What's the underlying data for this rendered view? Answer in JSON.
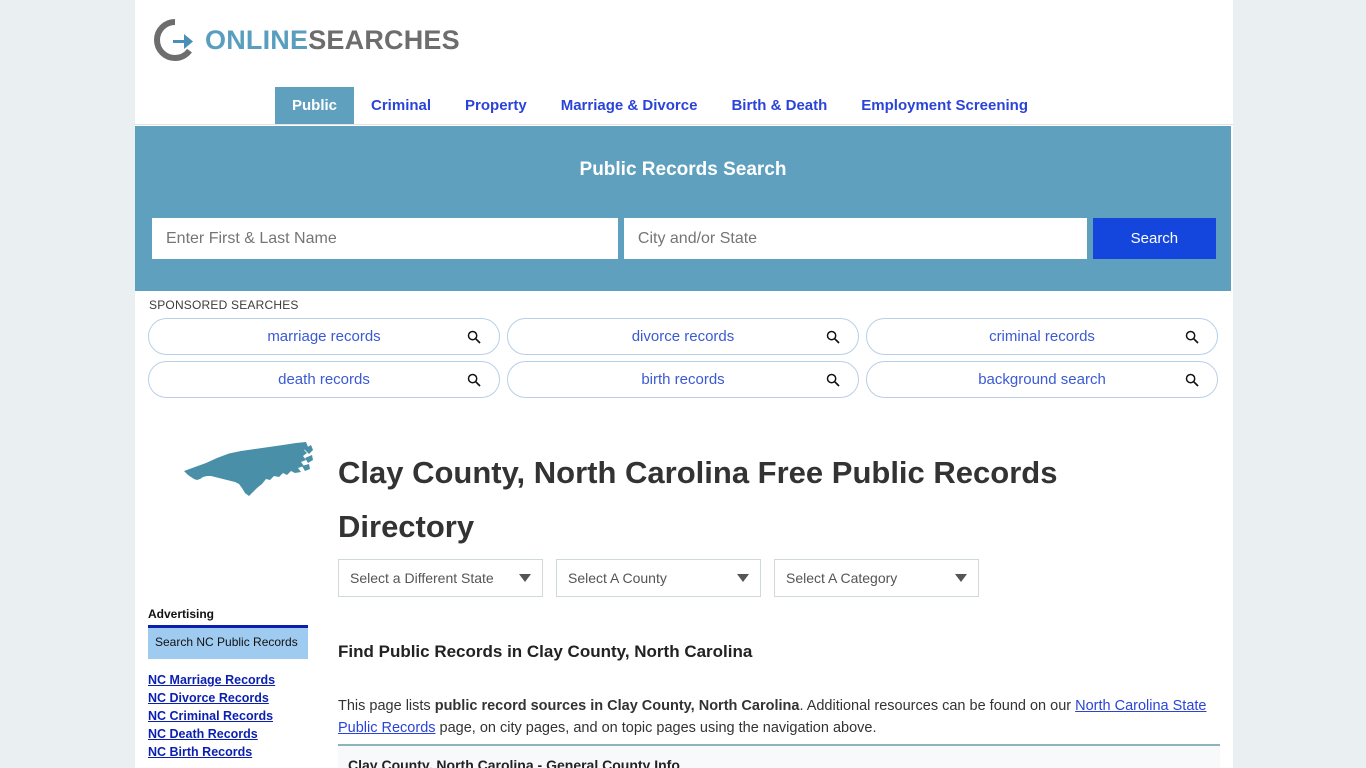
{
  "brand": {
    "name_part1": "ONLINE",
    "name_part2": "SEARCHES",
    "logo_icon": "circle-arrow-icon",
    "color_blue": "#5a9ebf",
    "color_gray": "#6d6d6d"
  },
  "nav": {
    "tabs": [
      {
        "label": "Public",
        "active": true
      },
      {
        "label": "Criminal",
        "active": false
      },
      {
        "label": "Property",
        "active": false
      },
      {
        "label": "Marriage & Divorce",
        "active": false
      },
      {
        "label": "Birth & Death",
        "active": false
      },
      {
        "label": "Employment Screening",
        "active": false
      }
    ],
    "active_bg": "#5fa0bf",
    "link_color": "#2b44d8"
  },
  "search_panel": {
    "title": "Public Records Search",
    "background": "#5fa0bf",
    "name_value": "",
    "name_placeholder": "Enter First & Last Name",
    "city_value": "",
    "city_placeholder": "City and/or State",
    "button_label": "Search",
    "button_color": "#1446dd"
  },
  "sponsored": {
    "label": "SPONSORED SEARCHES",
    "pills": [
      {
        "label": "marriage records",
        "icon": "search-icon"
      },
      {
        "label": "divorce records",
        "icon": "search-icon"
      },
      {
        "label": "criminal records",
        "icon": "search-icon"
      },
      {
        "label": "death records",
        "icon": "search-icon"
      },
      {
        "label": "birth records",
        "icon": "search-icon"
      },
      {
        "label": "background search",
        "icon": "search-icon"
      }
    ],
    "pill_text_color": "#3a5ad4",
    "pill_border_color": "#b9cfe8"
  },
  "page": {
    "title": "Clay County, North Carolina Free Public Records Directory",
    "state_map_icon": "north-carolina-map-icon",
    "state_map_color": "#4a8fa8"
  },
  "selectors": [
    {
      "value": "Select a Different State"
    },
    {
      "value": "Select A County"
    },
    {
      "value": "Select A Category"
    }
  ],
  "sidebar": {
    "heading": "Advertising",
    "ad_box_text": "Search NC Public Records",
    "ad_box_bg": "#9fcbf0",
    "ad_box_rule": "#0a1fb0",
    "links": [
      {
        "label": "NC Marriage Records"
      },
      {
        "label": "NC Divorce Records"
      },
      {
        "label": "NC Criminal Records"
      },
      {
        "label": "NC Death Records"
      },
      {
        "label": "NC Birth Records"
      }
    ],
    "link_color": "#0a1fb0"
  },
  "content": {
    "heading": "Find Public Records in Clay County, North Carolina",
    "paragraph_part1": "This page lists ",
    "paragraph_bold": "public record sources in Clay County, North Carolina",
    "paragraph_part2": ". Additional resources can be found on our ",
    "paragraph_link": "North Carolina State Public Records",
    "paragraph_part3": " page, on city pages, and on topic pages using the navigation above.",
    "section_title": "Clay County, North Carolina - General County Info"
  }
}
